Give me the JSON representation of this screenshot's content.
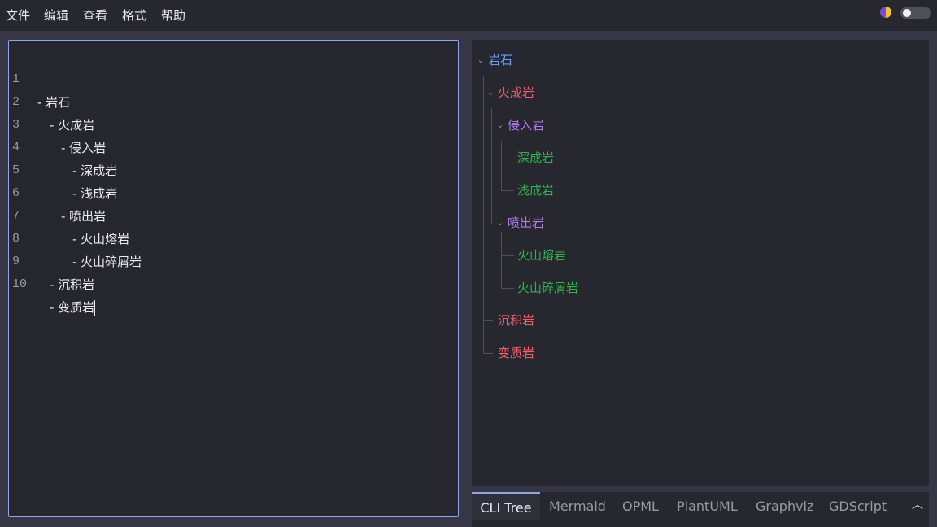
{
  "menu": [
    "文件",
    "编辑",
    "查看",
    "格式",
    "帮助"
  ],
  "colors": {
    "root": "#6c9cf5",
    "level1": "#f25f6c",
    "level2": "#b57af2",
    "level3": "#2fb34c",
    "active_border": "#8fa8ea"
  },
  "editor": {
    "lines": [
      {
        "n": "1",
        "text": "- 岩石"
      },
      {
        "n": "2",
        "text": "- 火成岩"
      },
      {
        "n": "3",
        "text": "- 侵入岩"
      },
      {
        "n": "4",
        "text": "- 深成岩"
      },
      {
        "n": "5",
        "text": "- 浅成岩"
      },
      {
        "n": "6",
        "text": "- 喷出岩"
      },
      {
        "n": "7",
        "text": "- 火山熔岩"
      },
      {
        "n": "8",
        "text": "- 火山碎屑岩"
      },
      {
        "n": "9",
        "text": "- 沉积岩"
      },
      {
        "n": "10",
        "text": "- 变质岩"
      }
    ]
  },
  "tree": {
    "root": "岩石",
    "igneous": "火成岩",
    "intrusive": "侵入岩",
    "plutonic": "深成岩",
    "hypabyssal": "浅成岩",
    "extrusive": "喷出岩",
    "lava": "火山熔岩",
    "pyroclastic": "火山碎屑岩",
    "sedimentary": "沉积岩",
    "metamorphic": "变质岩"
  },
  "tabs": [
    "CLI Tree",
    "Mermaid",
    "OPML",
    "PlantUML",
    "Graphviz",
    "GDScript"
  ],
  "active_tab": "CLI Tree"
}
